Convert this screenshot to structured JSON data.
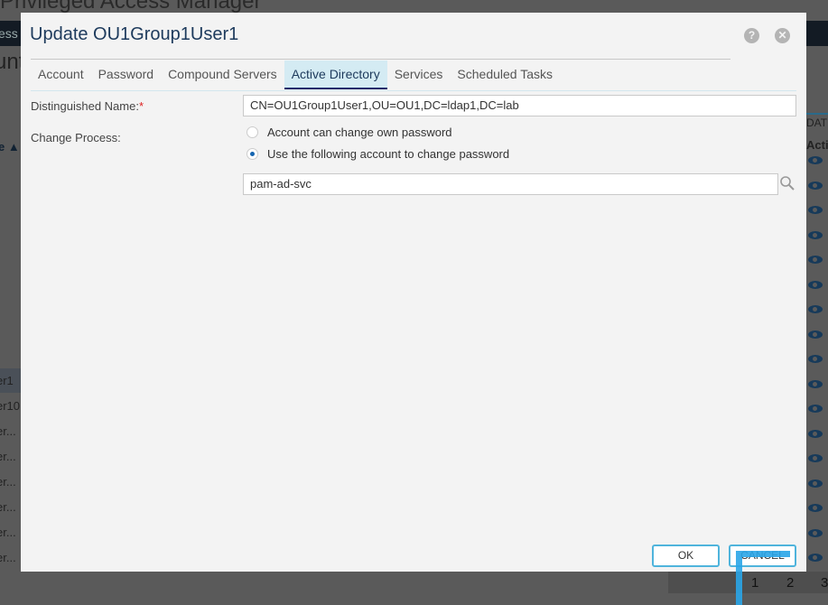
{
  "background": {
    "app_title": "Privileged Access Manager",
    "nav_fragment": "ess",
    "heading_fragment": "unt",
    "column_fragment": "e ▲",
    "rows": [
      "er1",
      "er10",
      "er...",
      "er...",
      "er...",
      "er...",
      "er...",
      "er..."
    ],
    "date_header": "DATE",
    "action_header": "Acti",
    "pager": [
      "1",
      "2",
      "3"
    ]
  },
  "dialog": {
    "title": "Update OU1Group1User1",
    "help_icon": "?",
    "close_icon": "✕",
    "tabs": [
      {
        "label": "Account",
        "active": false
      },
      {
        "label": "Password",
        "active": false
      },
      {
        "label": "Compound Servers",
        "active": false
      },
      {
        "label": "Active Directory",
        "active": true
      },
      {
        "label": "Services",
        "active": false
      },
      {
        "label": "Scheduled Tasks",
        "active": false
      }
    ],
    "distinguished_name_label": "Distinguished Name:",
    "required_mark": "*",
    "distinguished_name_value": "CN=OU1Group1User1,OU=OU1,DC=ldap1,DC=lab",
    "change_process_label": "Change Process:",
    "options": [
      {
        "label": "Account can change own password",
        "selected": false
      },
      {
        "label": "Use the following account to change password",
        "selected": true
      }
    ],
    "account_value": "pam-ad-svc",
    "ok_label": "OK",
    "cancel_label": "CANCEL"
  }
}
